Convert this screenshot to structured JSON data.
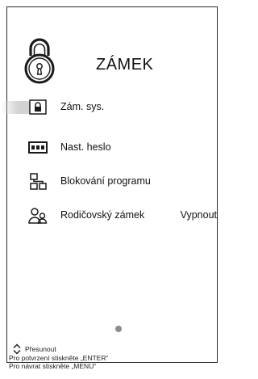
{
  "header": {
    "title": "ZÁMEK",
    "icon": "padlock-icon"
  },
  "menu": {
    "items": [
      {
        "label": "Zám. sys.",
        "icon": "lock-small-icon",
        "selected": true,
        "value": ""
      },
      {
        "label": "Nast. heslo",
        "icon": "password-dots-icon",
        "selected": false,
        "value": ""
      },
      {
        "label": "Blokování programu",
        "icon": "program-block-icon",
        "selected": false,
        "value": ""
      },
      {
        "label": "Rodičovský zámek",
        "icon": "parents-icon",
        "selected": false,
        "value": "Vypnout"
      }
    ]
  },
  "page_indicator": {
    "icon": "page-dot-icon"
  },
  "hints": {
    "move": "Přesunout",
    "confirm": "Pro potvrzení stiskněte „ENTER“",
    "back": "Pro návrat stiskněte „MENU“"
  }
}
